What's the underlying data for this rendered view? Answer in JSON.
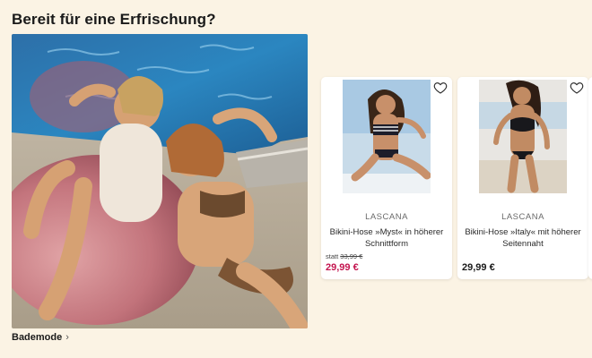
{
  "section": {
    "title": "Bereit für eine Erfrischung?",
    "category_link": "Bademode"
  },
  "colors": {
    "background": "#fbf3e4",
    "sale_price": "#c4154f",
    "card_bg": "#ffffff"
  },
  "products": [
    {
      "brand": "LASCANA",
      "name": "Bikini-Hose »Myst« in höherer Schnittform",
      "old_price_prefix": "statt",
      "old_price": "33,99 €",
      "price": "29,99 €",
      "on_sale": true
    },
    {
      "brand": "LASCANA",
      "name": "Bikini-Hose »Italy« mit höherer Seitennaht",
      "price": "29,99 €",
      "on_sale": false
    }
  ],
  "icons": {
    "wishlist": "heart-outline-icon",
    "chevron": "chevron-right-icon"
  }
}
